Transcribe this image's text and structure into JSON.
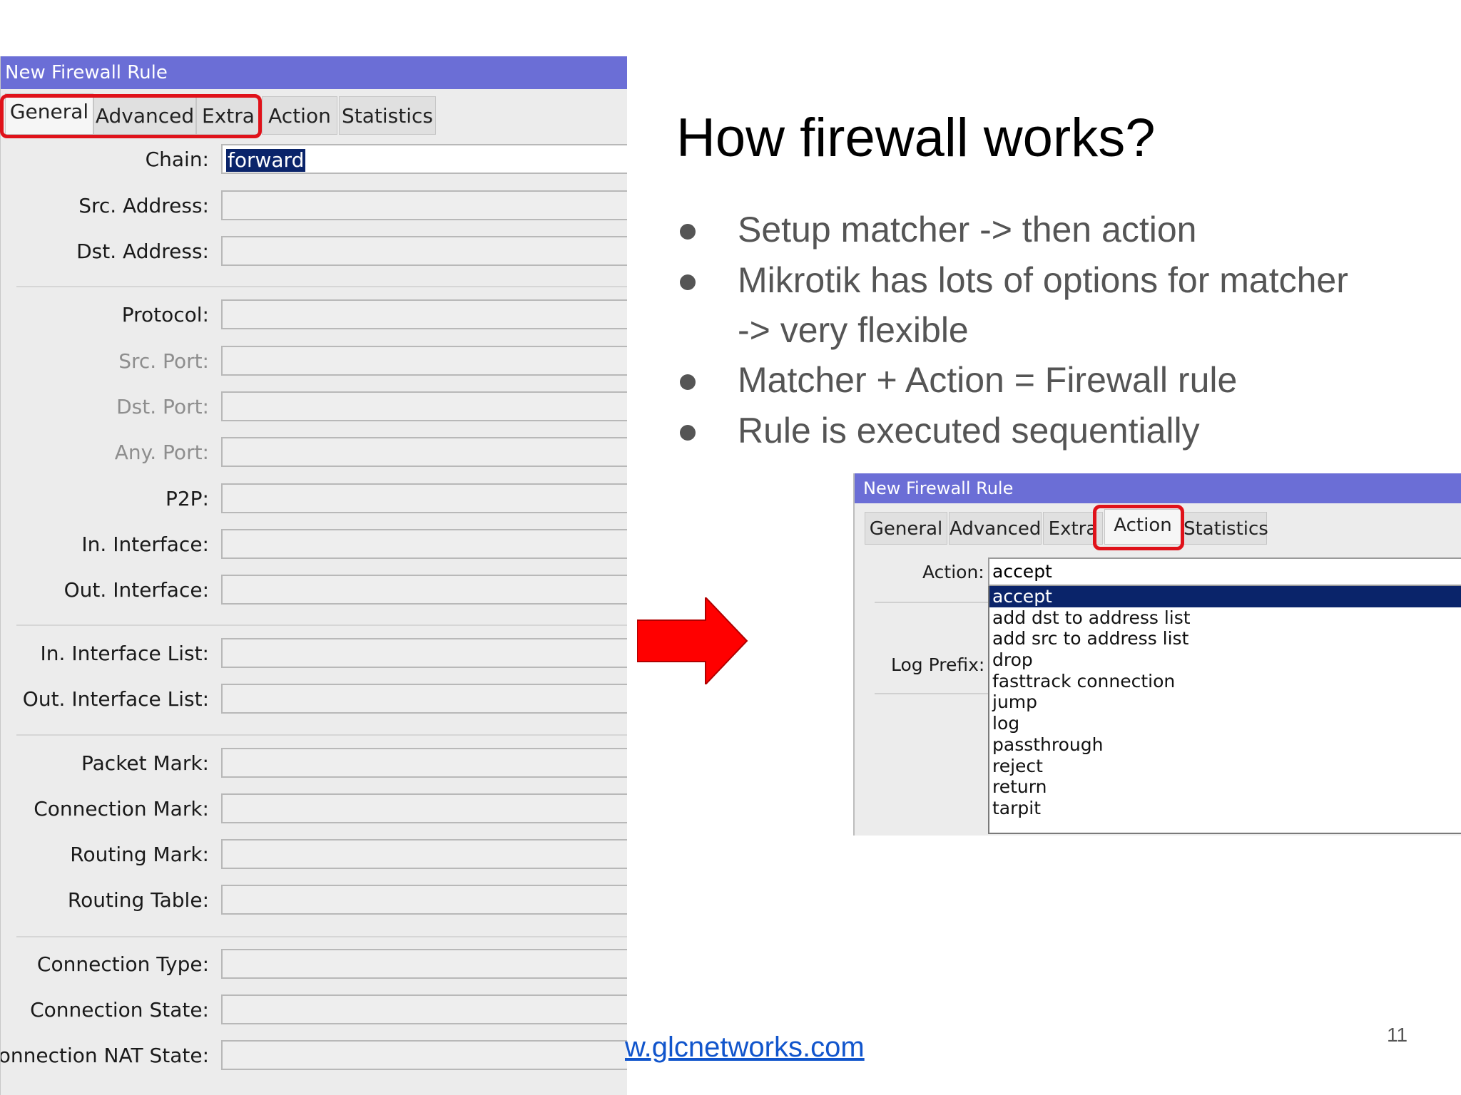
{
  "left_window": {
    "title": "New Firewall Rule",
    "tabs": [
      {
        "label": "General"
      },
      {
        "label": "Advanced"
      },
      {
        "label": "Extra"
      },
      {
        "label": "Action"
      },
      {
        "label": "Statistics"
      }
    ],
    "fields": [
      {
        "label": "Chain:",
        "value": "forward"
      },
      {
        "label": "Src. Address:",
        "value": ""
      },
      {
        "label": "Dst. Address:",
        "value": ""
      },
      {
        "label": "Protocol:",
        "value": ""
      },
      {
        "label": "Src. Port:",
        "value": ""
      },
      {
        "label": "Dst. Port:",
        "value": ""
      },
      {
        "label": "Any. Port:",
        "value": ""
      },
      {
        "label": "P2P:",
        "value": ""
      },
      {
        "label": "In. Interface:",
        "value": ""
      },
      {
        "label": "Out. Interface:",
        "value": ""
      },
      {
        "label": "In. Interface List:",
        "value": ""
      },
      {
        "label": "Out. Interface List:",
        "value": ""
      },
      {
        "label": "Packet Mark:",
        "value": ""
      },
      {
        "label": "Connection Mark:",
        "value": ""
      },
      {
        "label": "Routing Mark:",
        "value": ""
      },
      {
        "label": "Routing Table:",
        "value": ""
      },
      {
        "label": "Connection Type:",
        "value": ""
      },
      {
        "label": "Connection State:",
        "value": ""
      },
      {
        "label": "Connection NAT State:",
        "value": ""
      }
    ]
  },
  "slide": {
    "title": "How firewall works?",
    "bullets": [
      {
        "line1": "Setup matcher -> then action"
      },
      {
        "line1": "Mikrotik has lots of options for matcher",
        "line2": "-> very flexible"
      },
      {
        "line1": "Matcher + Action = Firewall rule"
      },
      {
        "line1": "Rule is executed sequentially"
      }
    ],
    "url": "w.glcnetworks.com",
    "page_number": "11",
    "colors": {
      "title_bar": "#6b6ed6",
      "highlight_box": "#e0121a",
      "arrow": "#ff0000",
      "link": "#1155cc"
    }
  },
  "right_window": {
    "title": "New Firewall Rule",
    "tabs": [
      {
        "label": "General"
      },
      {
        "label": "Advanced"
      },
      {
        "label": "Extra"
      },
      {
        "label": "Action"
      },
      {
        "label": "Statistics"
      }
    ],
    "action_label": "Action:",
    "action_value": "accept",
    "log_prefix_label": "Log Prefix:",
    "options": [
      "accept",
      "add dst to address list",
      "add src to address list",
      "drop",
      "fasttrack connection",
      "jump",
      "log",
      "passthrough",
      "reject",
      "return",
      "tarpit"
    ],
    "selected_option": "accept"
  }
}
